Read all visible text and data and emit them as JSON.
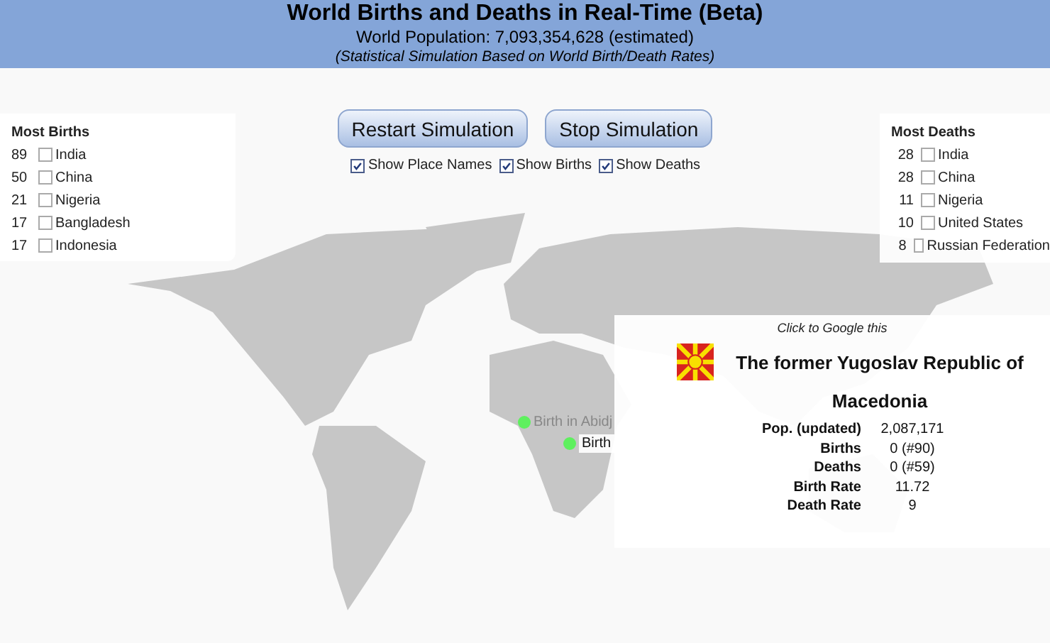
{
  "header": {
    "title": "World Births and Deaths in Real-Time (Beta)",
    "population": "World Population: 7,093,354,628 (estimated)",
    "subtitle": "(Statistical Simulation Based on World Birth/Death Rates)"
  },
  "buttons": [
    "Restart Simulation",
    "Stop Simulation"
  ],
  "toggles": [
    {
      "label": "Show Place Names",
      "checked": true
    },
    {
      "label": "Show Births",
      "checked": true
    },
    {
      "label": "Show Deaths",
      "checked": true
    }
  ],
  "most_births": {
    "title": "Most Births",
    "items": [
      {
        "count": "89",
        "name": "India",
        "checked": false
      },
      {
        "count": "50",
        "name": "China",
        "checked": false
      },
      {
        "count": "21",
        "name": "Nigeria",
        "checked": false
      },
      {
        "count": "17",
        "name": "Bangladesh",
        "checked": false
      },
      {
        "count": "17",
        "name": "Indonesia",
        "checked": false
      }
    ]
  },
  "most_deaths": {
    "title": "Most Deaths",
    "items": [
      {
        "count": "28",
        "name": "India",
        "checked": false
      },
      {
        "count": "28",
        "name": "China",
        "checked": false
      },
      {
        "count": "11",
        "name": "Nigeria",
        "checked": false
      },
      {
        "count": "10",
        "name": "United States",
        "checked": false
      },
      {
        "count": "8",
        "name": "Russian Federation",
        "checked": false
      }
    ]
  },
  "map_markers": [
    {
      "kind": "birth",
      "label": "Birth in Abidj",
      "highlighted": false
    },
    {
      "kind": "birth",
      "label": "Birth",
      "highlighted": true
    }
  ],
  "popup": {
    "hint": "Click to Google this",
    "name": "The former Yugoslav Republic of Macedonia",
    "rows": [
      {
        "label": "Pop. (updated)",
        "value": "2,087,171"
      },
      {
        "label": "Births",
        "value": "0 (#90)"
      },
      {
        "label": "Deaths",
        "value": "0 (#59)"
      },
      {
        "label": "Birth Rate",
        "value": "11.72"
      },
      {
        "label": "Death Rate",
        "value": "9"
      }
    ]
  }
}
